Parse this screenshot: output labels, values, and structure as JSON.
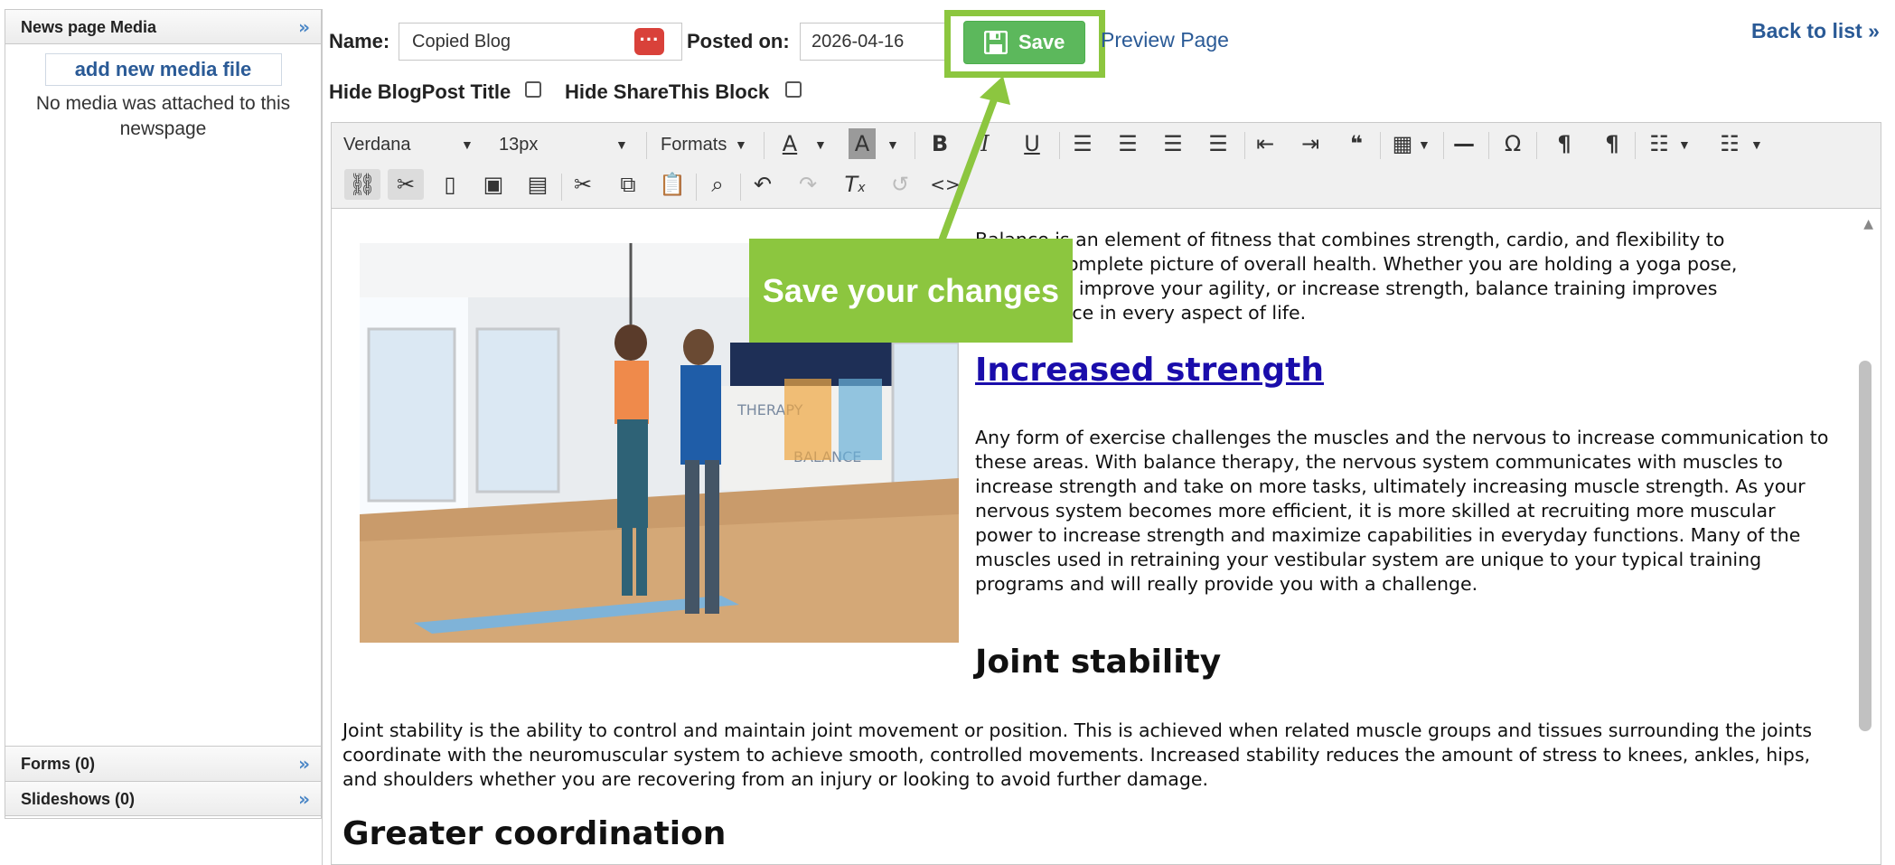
{
  "sidebar": {
    "media_title": "News page Media",
    "add_media_label": "add new media file",
    "no_media_text": "No media was attached to this newspage",
    "forms_label": "Forms (0)",
    "slideshows_label": "Slideshows (0)"
  },
  "form": {
    "name_label": "Name:",
    "name_value": "Copied Blog",
    "posted_label": "Posted on:",
    "posted_value": "2026-04-16",
    "save_label": "Save",
    "preview_label": "Preview Page",
    "back_label": "Back to list »",
    "hide_title_label": "Hide BlogPost Title",
    "hide_sharethis_label": "Hide ShareThis Block"
  },
  "toolbar": {
    "font_family": "Verdana",
    "font_size": "13px",
    "formats_label": "Formats"
  },
  "content": {
    "intro_lines": [
      "Balance is an element of fitness that combines strength, cardio, and flexibility to",
      "create a complete picture of overall health. Whether you are holding a yoga pose,",
      "working to improve your agility, or increase strength, balance training improves",
      "performance in every aspect of life."
    ],
    "heading1": "Increased strength ",
    "para1": "Any form of exercise challenges the muscles and the nervous to increase communication to these areas. With balance therapy, the nervous system communicates with muscles to increase strength and take on more tasks, ultimately increasing muscle strength. As your nervous system becomes more efficient, it is more skilled at recruiting more muscular power to increase strength and maximize capabilities in everyday functions. Many of the muscles used in retraining your vestibular system are unique to your typical training programs and will really provide you with a challenge.",
    "heading2": "Joint stability",
    "para2": "Joint stability is the ability to control and maintain joint movement or position. This is achieved when related muscle groups and tissues surrounding the joints coordinate with the neuromuscular system to achieve smooth, controlled movements. Increased stability reduces the amount of stress to knees, ankles, hips, and shoulders whether you are recovering from an injury or looking to avoid further damage.",
    "heading3": "Greater coordination",
    "photo_wall_text_1": "THERAPY",
    "photo_wall_text_2": "BALANCE"
  },
  "callout": {
    "text": "Save your changes"
  }
}
